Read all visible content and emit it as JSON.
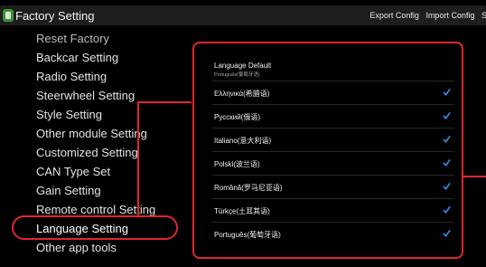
{
  "header": {
    "title": "Factory Setting",
    "actions": [
      "Export Config",
      "Import Config",
      "Sa"
    ]
  },
  "menu": {
    "items": [
      {
        "label": "Reset Factory"
      },
      {
        "label": "Backcar Setting"
      },
      {
        "label": "Radio Setting"
      },
      {
        "label": "Steerwheel Setting"
      },
      {
        "label": "Style Setting"
      },
      {
        "label": "Other module Setting"
      },
      {
        "label": "Customized Setting"
      },
      {
        "label": "CAN Type Set"
      },
      {
        "label": "Gain Setting"
      },
      {
        "label": "Remote control Setting"
      },
      {
        "label": "Language Setting"
      },
      {
        "label": "Other app tools"
      }
    ],
    "selected": "Language Setting"
  },
  "language_panel": {
    "default_title": "Language Default",
    "default_value": "Português(葡萄牙语)",
    "languages": [
      {
        "label": "Ελληνικά(希腊语)",
        "checked": true
      },
      {
        "label": "Русский(俄语)",
        "checked": true
      },
      {
        "label": "Italiano(意大利语)",
        "checked": true
      },
      {
        "label": "Polski(波兰语)",
        "checked": true
      },
      {
        "label": "Română(罗马尼亚语)",
        "checked": true
      },
      {
        "label": "Türkçe(土耳其语)",
        "checked": true
      },
      {
        "label": "Português(葡萄牙语)",
        "checked": true
      }
    ]
  },
  "colors": {
    "highlight": "#e0262e",
    "check": "#3b7fd6"
  }
}
